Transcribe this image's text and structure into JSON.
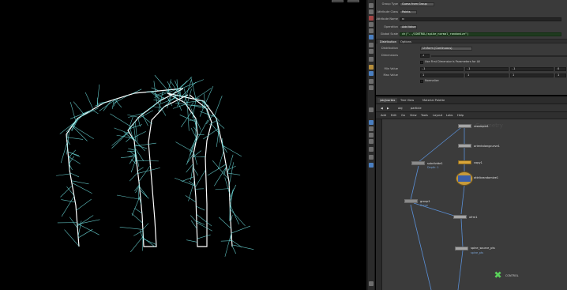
{
  "params": {
    "group_type_label": "Group Type",
    "group_type_value": "Guess from Group",
    "attribute_class_label": "Attribute Class",
    "attribute_class_value": "Points",
    "attribute_name_label": "Attribute Name",
    "attribute_name_value": "N",
    "operation_label": "Operation",
    "operation_value": "Add Value",
    "global_scale_label": "Global Scale",
    "global_scale_expr": "ch(\"../CONTROL/spike_normal_randomize\")",
    "tabs": [
      "Distribution",
      "Options"
    ],
    "distribution_label": "Distribution",
    "distribution_value": "Uniform (Continuous)",
    "dimensions_label": "Dimensions",
    "dimensions_value": "3",
    "use_first_dim_label": "Use First Dimension's Parameters for All",
    "min_value_label": "Min Value",
    "min_values": [
      "-1",
      "-1",
      "-1",
      "0"
    ],
    "max_value_label": "Max Value",
    "max_values": [
      "1",
      "1",
      "1",
      "1"
    ],
    "normalize_label": "Normalize"
  },
  "network": {
    "tabs": [
      "/obj/vortex",
      "Tree View",
      "Material Palette"
    ],
    "path": [
      "obj",
      "particle"
    ],
    "menu": [
      "Add",
      "Edit",
      "Go",
      "View",
      "Tools",
      "Layout",
      "Labs",
      "Help"
    ],
    "watermark": "Geometry",
    "nodes": {
      "resample": "resample1",
      "orient": "orientalongcurve1",
      "copy": "copy1",
      "attribrand": "attribrandomize1",
      "subdivide": "subdivide1",
      "subdivide_sub": "Depth: 1",
      "group": "group1",
      "group_sub": "Curve",
      "xform": "xfrm1",
      "spine": "spine_source_pts",
      "spine_sub": "spine_pts",
      "control": "CONTROL"
    }
  },
  "colors": {
    "viewport_bg": "#000000",
    "spike_color": "#6fe0e0",
    "curve_color": "#ffffff",
    "panel_bg": "#3a3a3a",
    "expression_bg": "#1f3a1f",
    "node_gold": "#d9a53a",
    "control_icon": "#5ad15a"
  }
}
